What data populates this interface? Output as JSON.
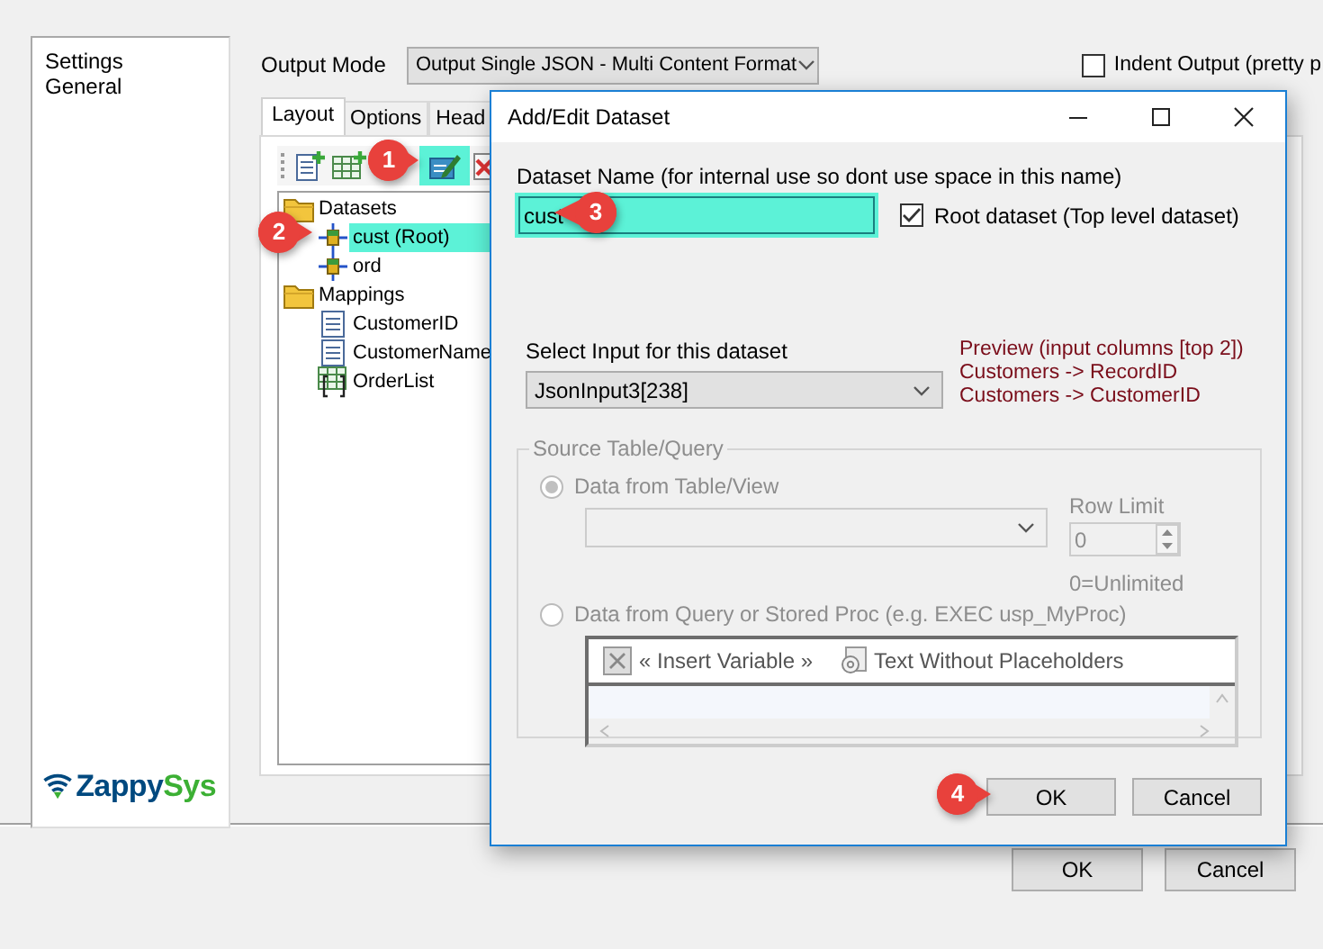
{
  "sidebar": {
    "items": [
      {
        "label": "Settings"
      },
      {
        "label": "General"
      }
    ],
    "logo": {
      "name_start": "Zappy",
      "name_end": "Sys"
    }
  },
  "output_mode": {
    "label": "Output Mode",
    "value": "Output Single JSON - Multi Content Format"
  },
  "indent_output": {
    "label": "Indent Output (pretty p",
    "checked": false
  },
  "tabs": [
    {
      "label": "Layout",
      "selected": true
    },
    {
      "label": "Options",
      "selected": false
    },
    {
      "label": "Head",
      "selected": false
    }
  ],
  "toolbar_buttons": [
    {
      "kind": "add",
      "highlighted": false
    },
    {
      "kind": "add_array",
      "highlighted": false
    },
    {
      "kind": "edit",
      "highlighted": true
    },
    {
      "kind": "delete",
      "highlighted": false
    }
  ],
  "tree": [
    {
      "label": "Datasets",
      "kind": "folder",
      "selected": false,
      "children": [
        {
          "label": "cust (Root)",
          "kind": "dataset",
          "selected": true
        },
        {
          "label": "ord",
          "kind": "dataset",
          "selected": false
        }
      ]
    },
    {
      "label": "Mappings",
      "kind": "folder",
      "selected": false,
      "children": [
        {
          "label": "CustomerID",
          "kind": "field",
          "selected": false
        },
        {
          "label": "CustomerName",
          "kind": "field",
          "selected": false
        },
        {
          "label": "OrderList",
          "kind": "array",
          "selected": false
        }
      ]
    }
  ],
  "dialog": {
    "title": "Add/Edit Dataset",
    "name_label": "Dataset Name (for internal use so dont use space in this name)",
    "name_value": "cust",
    "root_checkbox": {
      "label": "Root dataset (Top level dataset)",
      "checked": true
    },
    "input_label": "Select Input for this dataset",
    "input_value": "JsonInput3[238]",
    "preview": [
      "Preview (input columns [top 2])",
      "Customers -> RecordID",
      "Customers -> CustomerID"
    ],
    "source_group": {
      "title": "Source Table/Query",
      "disabled": true,
      "options": [
        {
          "label": "Data from Table/View",
          "selected": true
        },
        {
          "label": "Data from Query or Stored Proc (e.g. EXEC usp_MyProc)",
          "selected": false
        }
      ],
      "row_limit_label": "Row Limit",
      "row_limit_value": "0",
      "row_limit_hint": "0=Unlimited",
      "editor_buttons": [
        {
          "label": "« Insert Variable »",
          "kind": "variable"
        },
        {
          "label": "Text Without Placeholders",
          "kind": "text"
        }
      ]
    },
    "buttons": [
      "OK",
      "Cancel"
    ]
  },
  "buttons": [
    "OK",
    "Cancel"
  ],
  "callouts": [
    "1",
    "2",
    "3",
    "4"
  ]
}
